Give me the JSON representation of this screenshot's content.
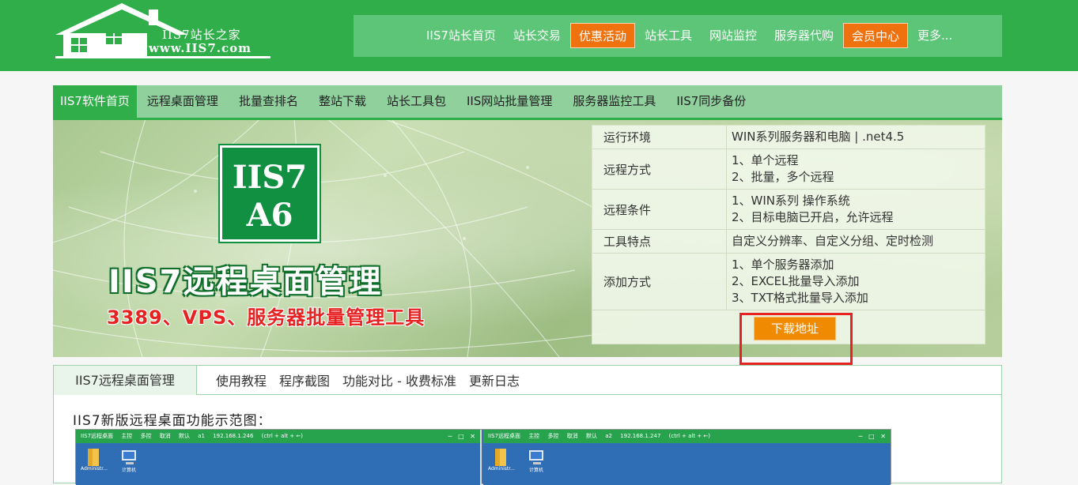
{
  "header": {
    "logo_line1": "IIS7站长之家",
    "logo_line2": "www.IIS7.com",
    "nav": [
      {
        "label": "IIS7站长首页",
        "highlight": false
      },
      {
        "label": "站长交易",
        "highlight": false
      },
      {
        "label": "优惠活动",
        "highlight": true
      },
      {
        "label": "站长工具",
        "highlight": false
      },
      {
        "label": "网站监控",
        "highlight": false
      },
      {
        "label": "服务器代购",
        "highlight": false
      },
      {
        "label": "会员中心",
        "highlight": true
      },
      {
        "label": "更多...",
        "highlight": false
      }
    ]
  },
  "subnav": {
    "items": [
      "IIS7软件首页",
      "远程桌面管理",
      "批量查排名",
      "整站下载",
      "站长工具包",
      "IIS网站批量管理",
      "服务器监控工具",
      "IIS7同步备份"
    ]
  },
  "banner": {
    "badge_line1": "IIS7",
    "badge_line2": "A6",
    "title": "IIS7远程桌面管理",
    "subtitle": "3389、VPS、服务器批量管理工具"
  },
  "info": {
    "rows": [
      {
        "key": "运行环境",
        "values": [
          "WIN系列服务器和电脑 | .net4.5"
        ]
      },
      {
        "key": "远程方式",
        "values": [
          "1、单个远程",
          "2、批量，多个远程"
        ]
      },
      {
        "key": "远程条件",
        "values": [
          "1、WIN系列 操作系统",
          "2、目标电脑已开启，允许远程"
        ]
      },
      {
        "key": "工具特点",
        "values": [
          "自定义分辨率、自定义分组、定时检测"
        ]
      },
      {
        "key": "添加方式",
        "values": [
          "1、单个服务器添加",
          "2、EXCEL批量导入添加",
          "3、TXT格式批量导入添加"
        ]
      }
    ],
    "download_label": "下载地址"
  },
  "tabs": {
    "active": "IIS7远程桌面管理",
    "items": [
      "使用教程",
      "程序截图",
      "功能对比 - 收费标准",
      "更新日志"
    ]
  },
  "content": {
    "section_title": "IIS7新版远程桌面功能示范图："
  },
  "screenshot": {
    "panes": [
      {
        "title": "IIS7远程桌面",
        "t1": "主控",
        "t2": "多控",
        "t3": "取消",
        "group": "默认",
        "id": "a1",
        "ip": "192.168.1.246",
        "keys": "(ctrl + alt + ←)",
        "icon1": "Administr...",
        "icon2": "计算机"
      },
      {
        "title": "IIS7远程桌面",
        "t1": "主控",
        "t2": "多控",
        "t3": "取消",
        "group": "默认",
        "id": "a2",
        "ip": "192.168.1.247",
        "keys": "(ctrl + alt + ←)",
        "icon1": "Administr...",
        "icon2": "计算机"
      }
    ]
  },
  "colors": {
    "brand_green": "#2fae4a",
    "nav_green": "#5cc577",
    "highlight_orange": "#f0720e",
    "download_orange": "#f08a00",
    "annotation_red": "#e62222"
  }
}
